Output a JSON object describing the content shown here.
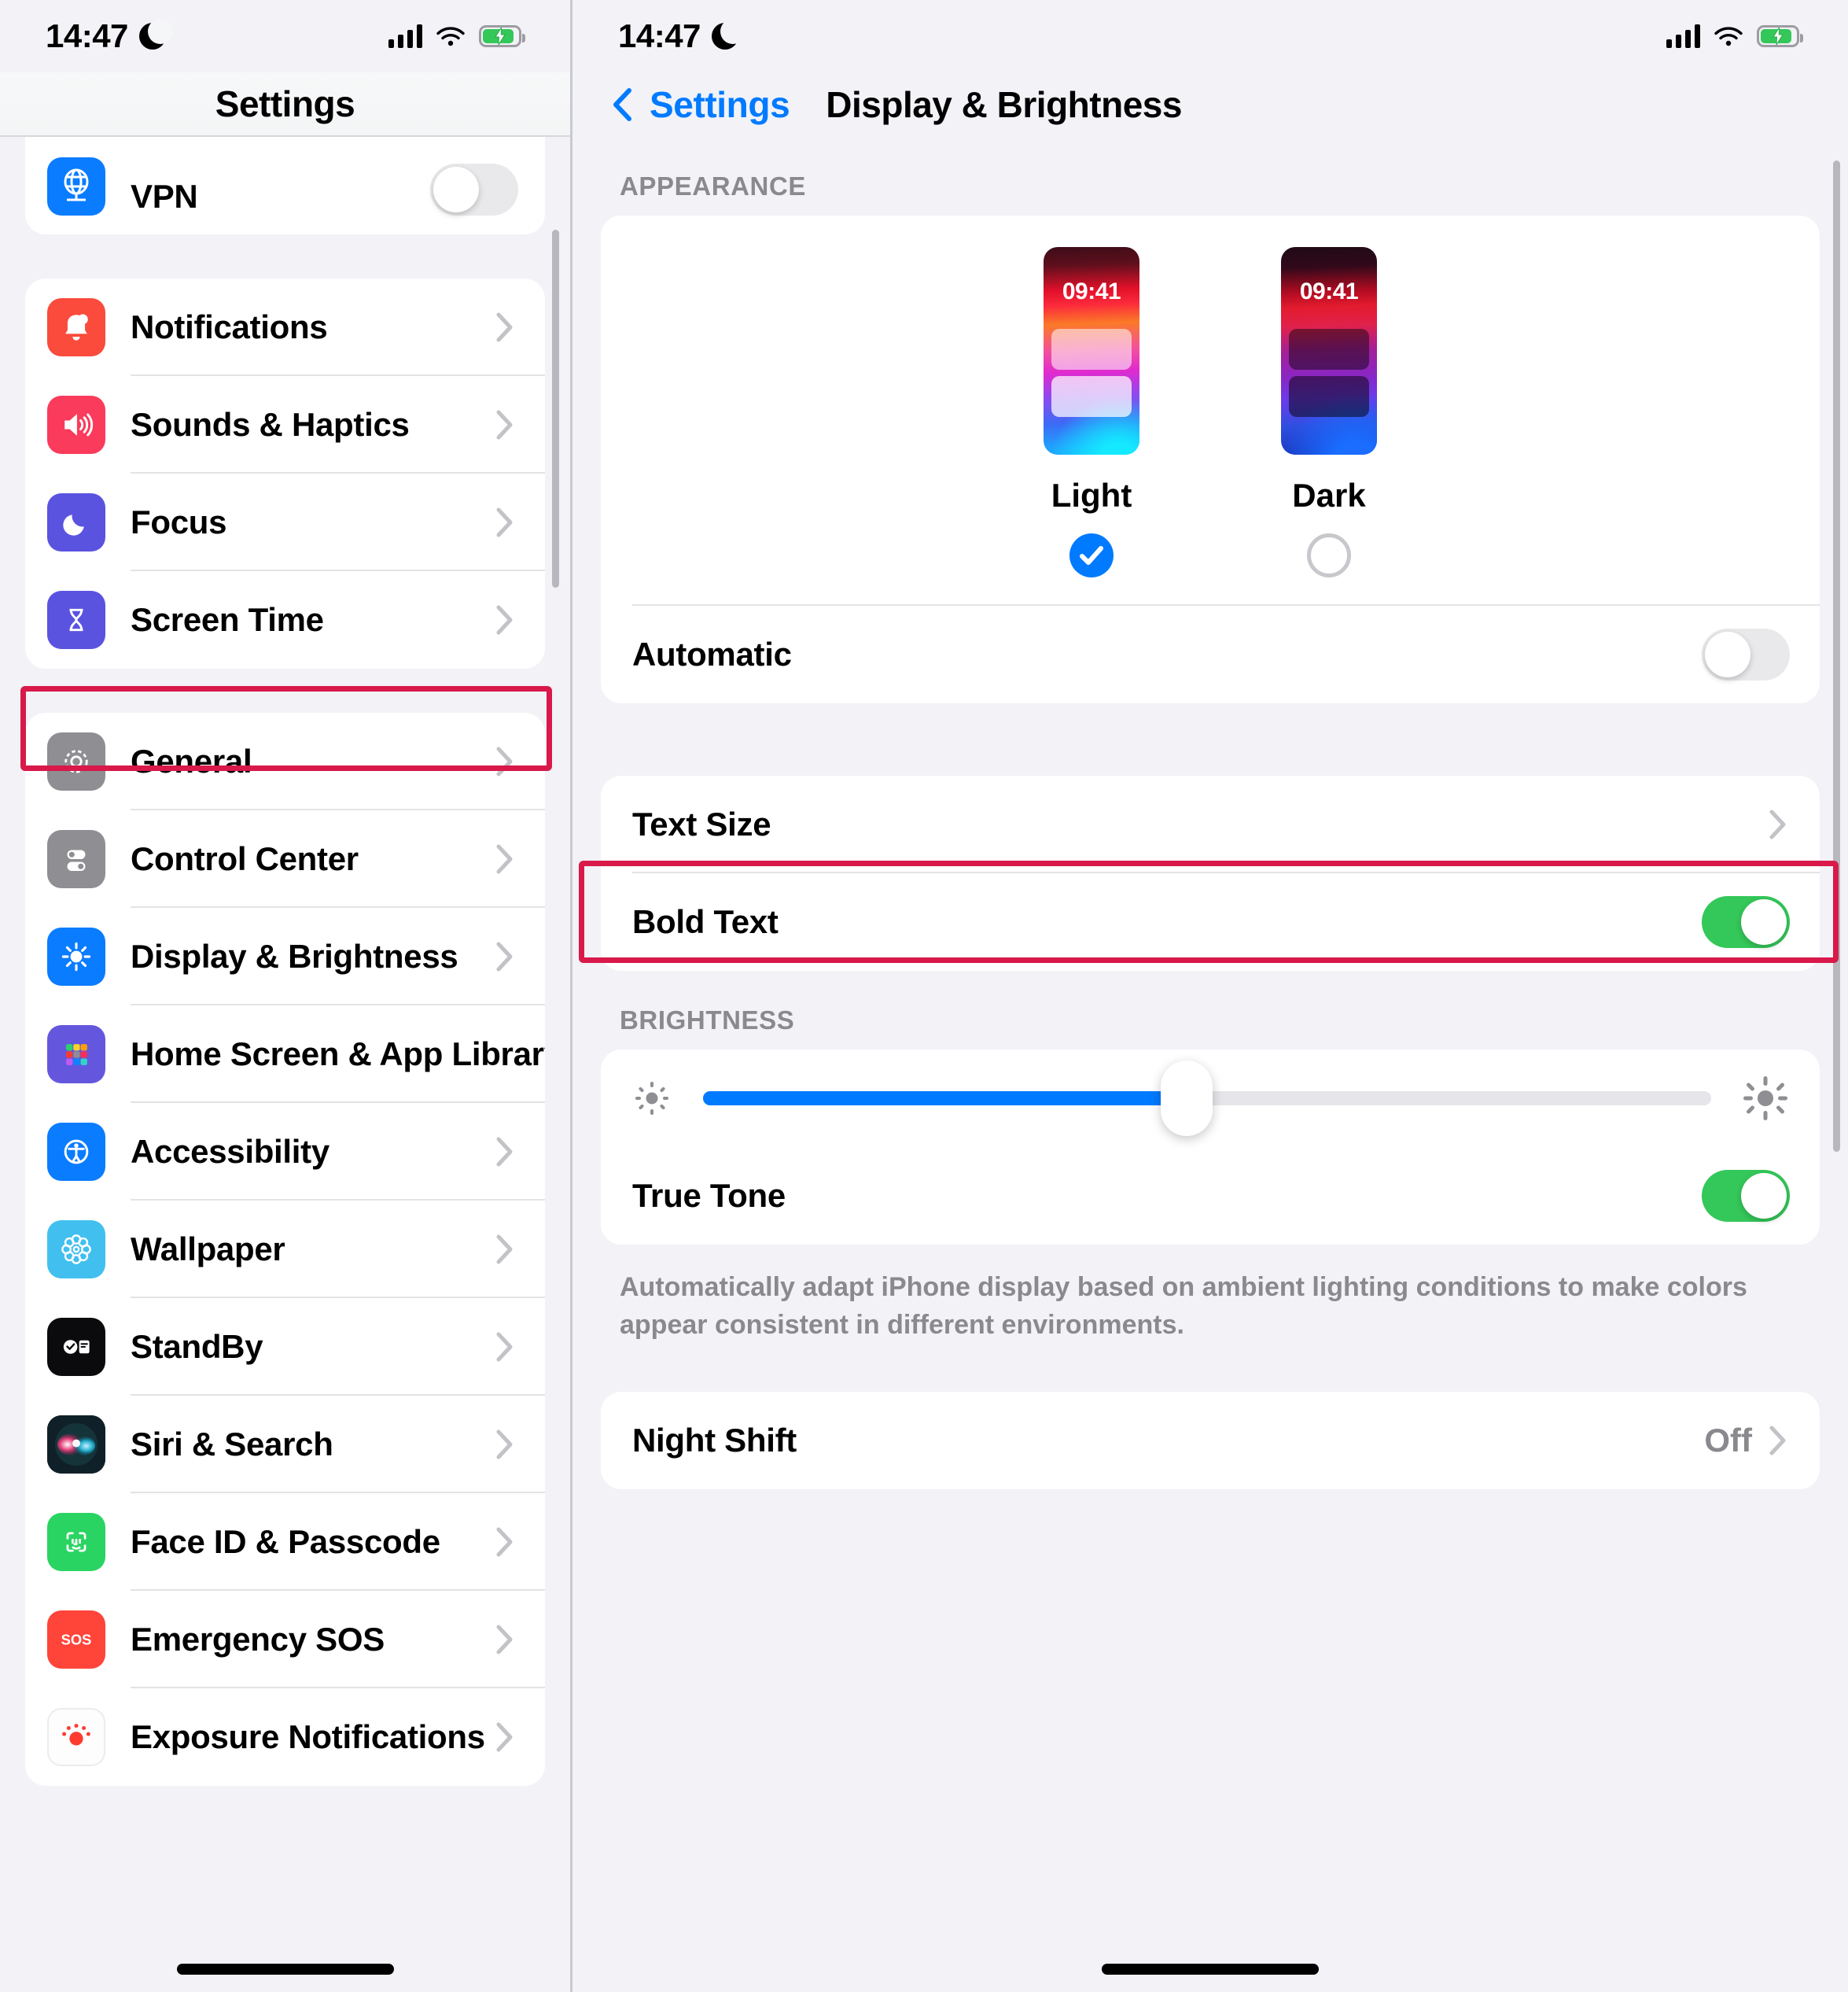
{
  "status_bar": {
    "time": "14:47",
    "focus_icon": "moon-icon",
    "signal_icon": "cellular-bars-icon",
    "wifi_icon": "wifi-icon",
    "battery_icon": "battery-charging-icon"
  },
  "left_panel": {
    "title": "Settings",
    "groups": [
      {
        "items": [
          {
            "label": "VPN",
            "icon": "vpn-globe-icon",
            "accessory": "toggle",
            "toggle_on": false
          }
        ]
      },
      {
        "items": [
          {
            "label": "Notifications",
            "icon": "bell-icon",
            "accessory": "chevron"
          },
          {
            "label": "Sounds & Haptics",
            "icon": "speaker-icon",
            "accessory": "chevron"
          },
          {
            "label": "Focus",
            "icon": "moon-icon",
            "accessory": "chevron"
          },
          {
            "label": "Screen Time",
            "icon": "hourglass-icon",
            "accessory": "chevron"
          }
        ]
      },
      {
        "items": [
          {
            "label": "General",
            "icon": "gear-icon",
            "accessory": "chevron"
          },
          {
            "label": "Control Center",
            "icon": "sliders-icon",
            "accessory": "chevron"
          },
          {
            "label": "Display & Brightness",
            "icon": "brightness-sun-icon",
            "accessory": "chevron",
            "highlighted": true
          },
          {
            "label": "Home Screen & App Library",
            "icon": "app-grid-icon",
            "accessory": "chevron"
          },
          {
            "label": "Accessibility",
            "icon": "accessibility-icon",
            "accessory": "chevron"
          },
          {
            "label": "Wallpaper",
            "icon": "flower-icon",
            "accessory": "chevron"
          },
          {
            "label": "StandBy",
            "icon": "standby-clock-icon",
            "accessory": "chevron"
          },
          {
            "label": "Siri & Search",
            "icon": "siri-orb-icon",
            "accessory": "chevron"
          },
          {
            "label": "Face ID & Passcode",
            "icon": "face-id-icon",
            "accessory": "chevron"
          },
          {
            "label": "Emergency SOS",
            "icon": "sos-icon",
            "accessory": "chevron"
          },
          {
            "label": "Exposure Notifications",
            "icon": "exposure-icon",
            "accessory": "chevron"
          }
        ]
      }
    ]
  },
  "right_panel": {
    "back_label": "Settings",
    "back_icon": "chevron-left-icon",
    "title": "Display & Brightness",
    "appearance": {
      "header": "APPEARANCE",
      "options": [
        {
          "name": "Light",
          "preview_time": "09:41",
          "selected": true
        },
        {
          "name": "Dark",
          "preview_time": "09:41",
          "selected": false
        }
      ],
      "automatic_label": "Automatic",
      "automatic_on": false
    },
    "text_group": [
      {
        "label": "Text Size",
        "accessory": "chevron"
      },
      {
        "label": "Bold Text",
        "accessory": "toggle",
        "toggle_on": true
      }
    ],
    "brightness": {
      "header": "BRIGHTNESS",
      "value_percent": 48,
      "low_icon": "sun-min-icon",
      "high_icon": "sun-max-icon",
      "highlighted": true,
      "true_tone_label": "True Tone",
      "true_tone_on": true,
      "footer": "Automatically adapt iPhone display based on ambient lighting conditions to make colors appear consistent in different environments."
    },
    "night_shift": {
      "label": "Night Shift",
      "value": "Off",
      "accessory": "chevron"
    }
  },
  "colors": {
    "accent_blue": "#007aff",
    "toggle_green": "#34c759",
    "highlight_red": "#d8194a",
    "secondary_gray": "#8a8a8e"
  }
}
